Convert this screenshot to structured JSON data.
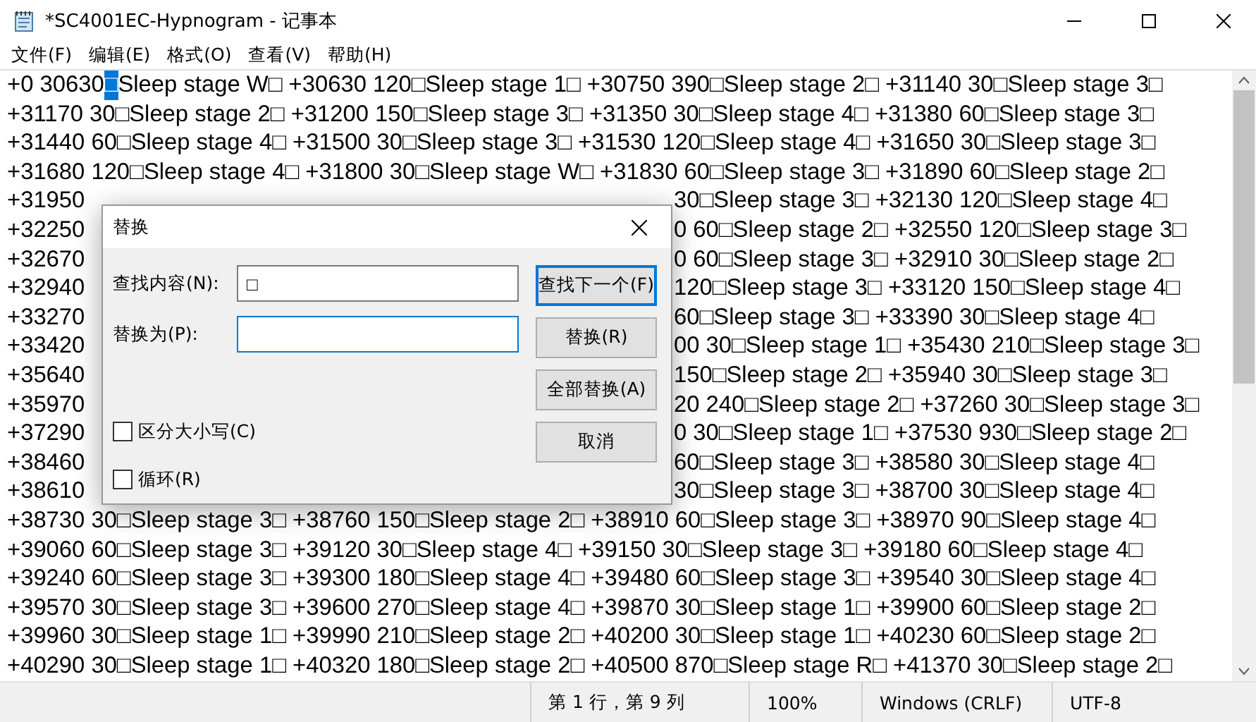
{
  "window": {
    "title": "*SC4001EC-Hypnogram - 记事本"
  },
  "menu": [
    {
      "label": "文件(F)"
    },
    {
      "label": "编辑(E)"
    },
    {
      "label": "格式(O)"
    },
    {
      "label": "查看(V)"
    },
    {
      "label": "帮助(H)"
    }
  ],
  "editor": {
    "rows": [
      {
        "kind": "full",
        "segments": [
          {
            "text": "+0 30630",
            "selected": false
          },
          {
            "text": "□",
            "selected": true
          },
          {
            "text": "Sleep stage W□ +30630 120□Sleep stage 1□ +30750 390□Sleep stage 2□ +31140 30□Sleep stage 3□",
            "selected": false
          }
        ]
      },
      {
        "kind": "full",
        "segments": [
          {
            "text": "+31170 30□Sleep stage 2□ +31200 150□Sleep stage 3□ +31350 30□Sleep stage 4□ +31380 60□Sleep stage 3□",
            "selected": false
          }
        ]
      },
      {
        "kind": "full",
        "segments": [
          {
            "text": "+31440 60□Sleep stage 4□ +31500 30□Sleep stage 3□ +31530 120□Sleep stage 4□ +31650 30□Sleep stage 3□",
            "selected": false
          }
        ]
      },
      {
        "kind": "full",
        "segments": [
          {
            "text": "+31680 120□Sleep stage 4□ +31800 30□Sleep stage W□ +31830 60□Sleep stage 3□ +31890 60□Sleep stage 2□",
            "selected": false
          }
        ]
      },
      {
        "kind": "covered",
        "segments": [
          {
            "text": "+31950",
            "selected": false
          },
          {
            "text": "30□Sleep stage 3□ +32130 120□Sleep stage 4□",
            "selected": false
          }
        ]
      },
      {
        "kind": "covered",
        "segments": [
          {
            "text": "+32250",
            "selected": false
          },
          {
            "text": "0 60□Sleep stage 2□ +32550 120□Sleep stage 3□",
            "selected": false
          }
        ]
      },
      {
        "kind": "covered",
        "segments": [
          {
            "text": "+32670",
            "selected": false
          },
          {
            "text": "0 60□Sleep stage 3□ +32910 30□Sleep stage 2□",
            "selected": false
          }
        ]
      },
      {
        "kind": "covered",
        "segments": [
          {
            "text": "+32940",
            "selected": false
          },
          {
            "text": "120□Sleep stage 3□ +33120 150□Sleep stage 4□",
            "selected": false
          }
        ]
      },
      {
        "kind": "covered",
        "segments": [
          {
            "text": "+33270",
            "selected": false
          },
          {
            "text": "60□Sleep stage 3□ +33390 30□Sleep stage 4□",
            "selected": false
          }
        ]
      },
      {
        "kind": "covered",
        "segments": [
          {
            "text": "+33420",
            "selected": false
          },
          {
            "text": "00 30□Sleep stage 1□ +35430 210□Sleep stage 3□",
            "selected": false
          }
        ]
      },
      {
        "kind": "covered",
        "segments": [
          {
            "text": "+35640",
            "selected": false
          },
          {
            "text": "150□Sleep stage 2□ +35940 30□Sleep stage 3□",
            "selected": false
          }
        ]
      },
      {
        "kind": "covered",
        "segments": [
          {
            "text": "+35970",
            "selected": false
          },
          {
            "text": "20 240□Sleep stage 2□ +37260 30□Sleep stage 3□",
            "selected": false
          }
        ]
      },
      {
        "kind": "covered",
        "segments": [
          {
            "text": "+37290",
            "selected": false
          },
          {
            "text": "0 30□Sleep stage 1□ +37530 930□Sleep stage 2□",
            "selected": false
          }
        ]
      },
      {
        "kind": "covered",
        "segments": [
          {
            "text": "+38460",
            "selected": false
          },
          {
            "text": "60□Sleep stage 3□ +38580 30□Sleep stage 4□",
            "selected": false
          }
        ]
      },
      {
        "kind": "covered",
        "segments": [
          {
            "text": "+38610",
            "selected": false
          },
          {
            "text": "30□Sleep stage 3□ +38700 30□Sleep stage 4□",
            "selected": false
          }
        ]
      },
      {
        "kind": "full",
        "segments": [
          {
            "text": "+38730 30□Sleep stage 3□ +38760 150□Sleep stage 2□ +38910 60□Sleep stage 3□ +38970 90□Sleep stage 4□",
            "selected": false
          }
        ]
      },
      {
        "kind": "full",
        "segments": [
          {
            "text": "+39060 60□Sleep stage 3□ +39120 30□Sleep stage 4□ +39150 30□Sleep stage 3□ +39180 60□Sleep stage 4□",
            "selected": false
          }
        ]
      },
      {
        "kind": "full",
        "segments": [
          {
            "text": "+39240 60□Sleep stage 3□ +39300 180□Sleep stage 4□ +39480 60□Sleep stage 3□ +39540 30□Sleep stage 4□",
            "selected": false
          }
        ]
      },
      {
        "kind": "full",
        "segments": [
          {
            "text": "+39570 30□Sleep stage 3□ +39600 270□Sleep stage 4□ +39870 30□Sleep stage 1□ +39900 60□Sleep stage 2□",
            "selected": false
          }
        ]
      },
      {
        "kind": "full",
        "segments": [
          {
            "text": "+39960 30□Sleep stage 1□ +39990 210□Sleep stage 2□ +40200 30□Sleep stage 1□ +40230 60□Sleep stage 2□",
            "selected": false
          }
        ]
      },
      {
        "kind": "full",
        "segments": [
          {
            "text": "+40290 30□Sleep stage 1□ +40320 180□Sleep stage 2□ +40500 870□Sleep stage R□ +41370 30□Sleep stage 2□",
            "selected": false
          }
        ]
      }
    ]
  },
  "status_bar": [
    {
      "text": "第 1 行，第 9 列"
    },
    {
      "text": "100%"
    },
    {
      "text": "Windows (CRLF)"
    },
    {
      "text": "UTF-8"
    }
  ],
  "dialog": {
    "title": "替换",
    "fields": [
      {
        "label": "查找内容(N):",
        "value": "□",
        "focused": false
      },
      {
        "label": "替换为(P):",
        "focused": true
      }
    ],
    "buttons": [
      {
        "label": "查找下一个(F)",
        "default": true
      },
      {
        "label": "替换(R)",
        "default": false
      },
      {
        "label": "全部替换(A)",
        "default": false
      },
      {
        "label": "取消",
        "default": false
      }
    ],
    "options": [
      {
        "label": "区分大小写(C)",
        "checked": false
      },
      {
        "label": "循环(R)",
        "checked": false
      }
    ]
  }
}
